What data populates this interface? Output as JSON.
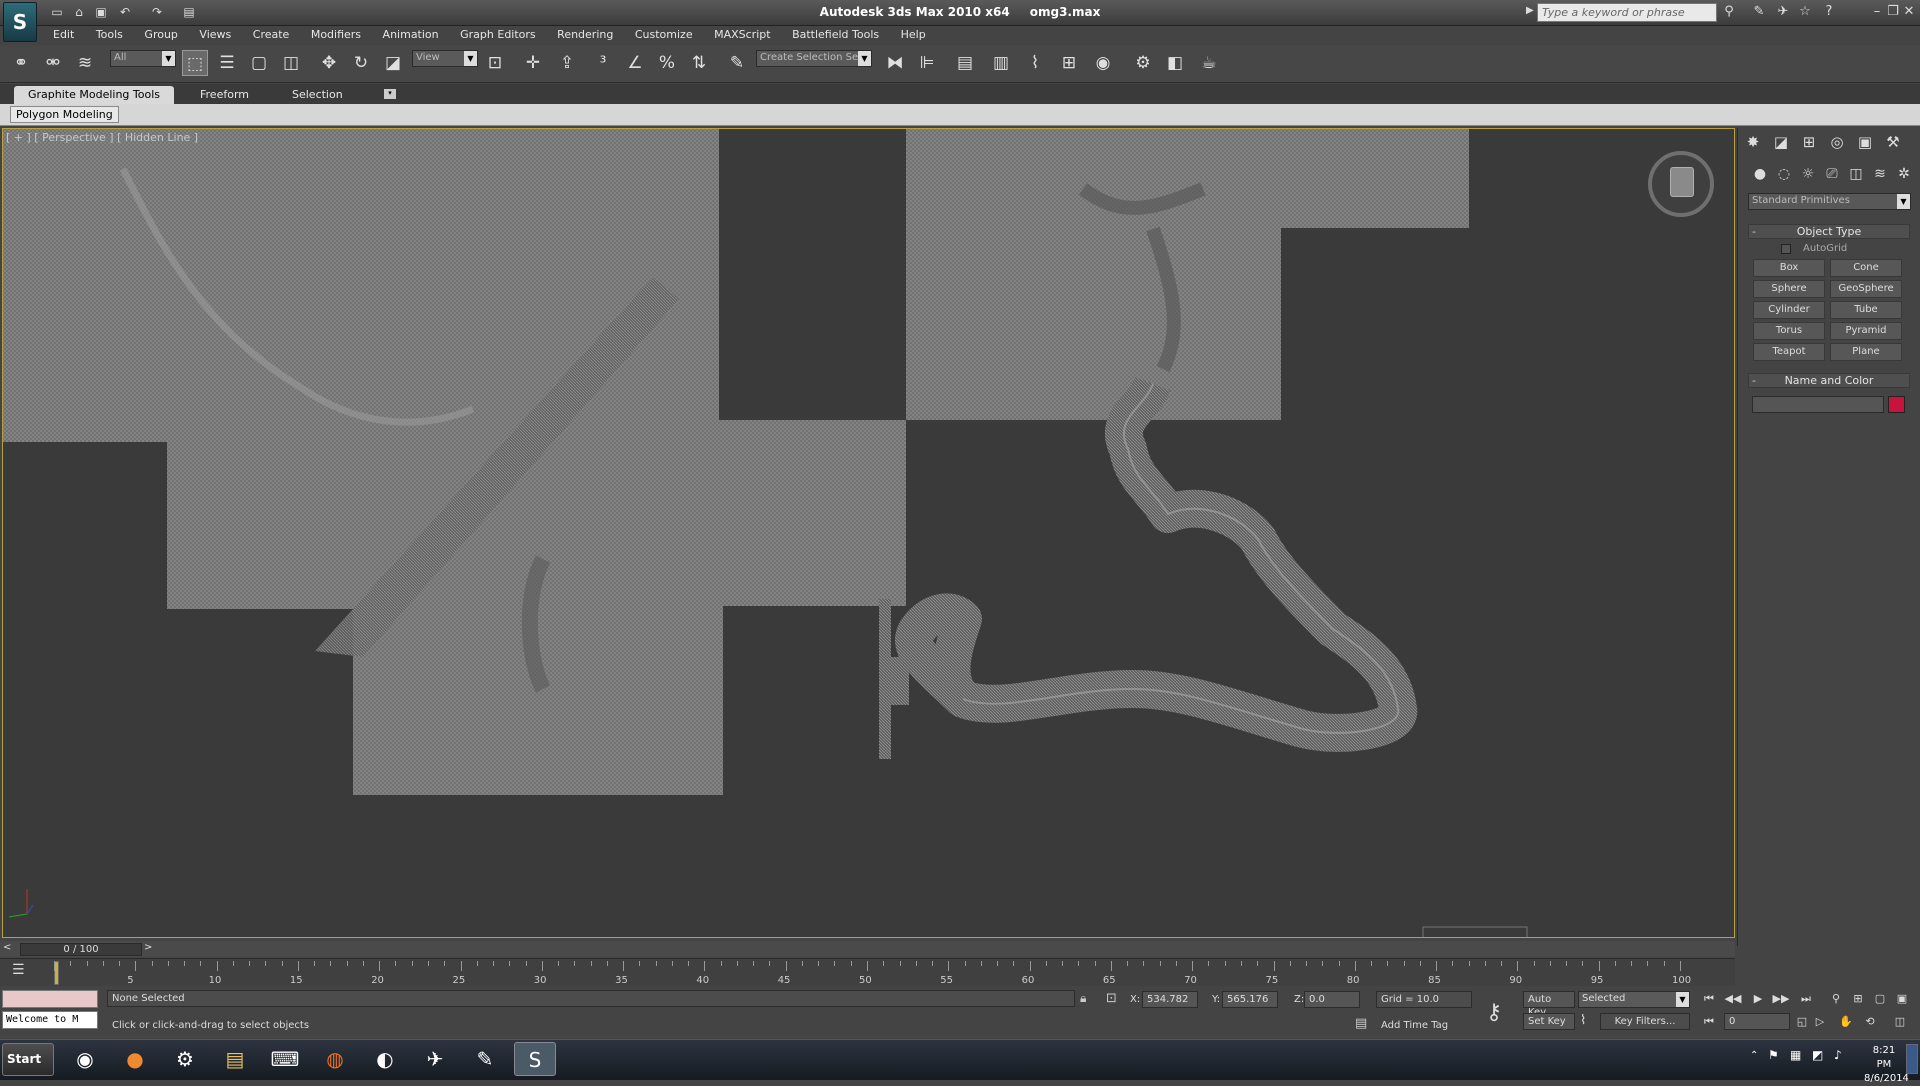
{
  "app": {
    "title": "Autodesk 3ds Max  2010 x64",
    "file": "omg3.max",
    "search_placeholder": "Type a keyword or phrase",
    "logo_icon": "3dsmax-logo-icon"
  },
  "menu": [
    "Edit",
    "Tools",
    "Group",
    "Views",
    "Create",
    "Modifiers",
    "Animation",
    "Graph Editors",
    "Rendering",
    "Customize",
    "MAXScript",
    "Battlefield Tools",
    "Help"
  ],
  "toolbar": {
    "filter_value": "All",
    "refcoord_value": "View",
    "selection_set_value": "Create Selection Se"
  },
  "ribbon": {
    "tabs": [
      "Graphite Modeling Tools",
      "Freeform",
      "Selection"
    ],
    "panel_label": "Polygon Modeling"
  },
  "viewport": {
    "label": "[ + ] [ Perspective ] [ Hidden Line ]",
    "wire_color": "#8e8e8e",
    "bg_color": "#3a3a3a"
  },
  "command_panel": {
    "category": "Standard Primitives",
    "object_type_title": "Object Type",
    "autogrid": "AutoGrid",
    "buttons": [
      "Box",
      "Cone",
      "Sphere",
      "GeoSphere",
      "Cylinder",
      "Tube",
      "Torus",
      "Pyramid",
      "Teapot",
      "Plane"
    ],
    "name_color_title": "Name and Color",
    "object_color": "#c8143c"
  },
  "timeline": {
    "frame": "0 / 100",
    "ticks": [
      "5",
      "10",
      "15",
      "20",
      "25",
      "30",
      "35",
      "40",
      "45",
      "50",
      "55",
      "60",
      "65",
      "70",
      "75",
      "80",
      "85",
      "90",
      "95",
      "100"
    ]
  },
  "status": {
    "selection": "None Selected",
    "prompt": "Click or click-and-drag to select objects",
    "welcome": "Welcome to M",
    "x_label": "X:",
    "x_value": "534.782",
    "y_label": "Y:",
    "y_value": "565.176",
    "z_label": "Z:",
    "z_value": "0.0",
    "grid": "Grid = 10.0",
    "add_time_tag": "Add Time Tag",
    "auto_key": "Auto Key",
    "set_key": "Set Key",
    "key_mode": "Selected",
    "key_filters": "Key Filters...",
    "frame_field": "0"
  },
  "taskbar": {
    "start": "Start",
    "time": "8:21 PM",
    "date": "8/6/2014"
  }
}
